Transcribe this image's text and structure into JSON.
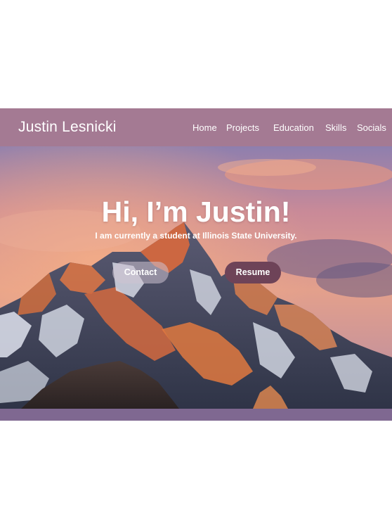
{
  "header": {
    "brand": "Justin Lesnicki",
    "nav": [
      "Home",
      "Projects",
      "Education",
      "Skills",
      "Socials"
    ]
  },
  "hero": {
    "title": "Hi, I’m Justin!",
    "subtitle": "I am currently a student at Illinois State University.",
    "buttons": {
      "contact": "Contact",
      "resume": "Resume"
    }
  },
  "colors": {
    "navbar": "#a47a93",
    "resume_button": "#6e4358",
    "footer_bar": "#7f6891"
  }
}
